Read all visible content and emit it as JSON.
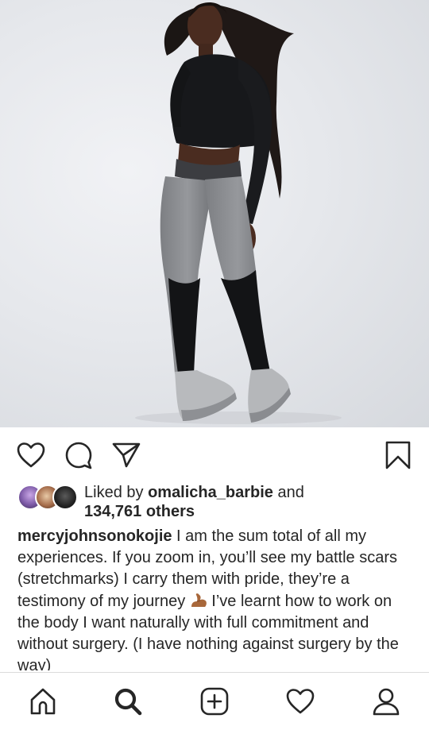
{
  "post": {
    "image_alt": "Woman in black crop top, grey and black leggings and silver sneakers posing against a light grey backdrop"
  },
  "actions": {
    "like_icon": "heart-outline-icon",
    "comment_icon": "comment-bubble-icon",
    "share_icon": "paper-plane-icon",
    "save_icon": "bookmark-icon"
  },
  "likes": {
    "prefix": "Liked by ",
    "user": "omalicha_barbie",
    "conjunction": " and",
    "others": "134,761 others"
  },
  "caption": {
    "username": "mercyjohnsonokojie",
    "text_before_emoji": " I am the sum total of all my experiences. If you zoom in, you’ll see my battle scars (stretchmarks) I carry them with pride, they’re a testimony of my journey ",
    "emoji": "flexed-biceps-emoji",
    "text_after_emoji": " I’ve learnt how to work on the body I want naturally with full commitment and without surgery. (I have nothing against surgery by the way)"
  },
  "nav": {
    "items": [
      "home-icon",
      "search-icon",
      "new-post-icon",
      "activity-heart-icon",
      "profile-icon"
    ]
  },
  "colors": {
    "text": "#262626",
    "divider": "#dbdbdb",
    "background": "#ffffff"
  }
}
